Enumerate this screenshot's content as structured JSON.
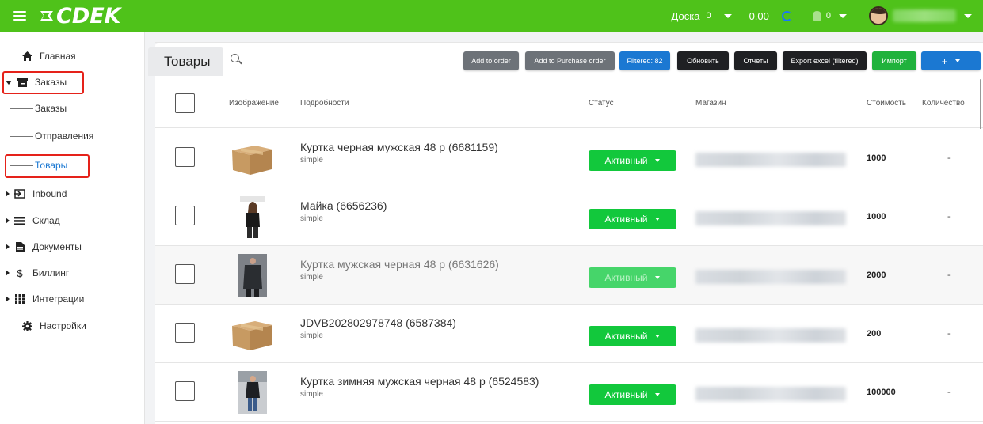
{
  "header": {
    "logo_text": "CDEK",
    "board_label": "Доска",
    "board_count": "0",
    "balance": "0.00",
    "notifications_count": "0"
  },
  "sidebar": {
    "items": [
      {
        "label": "Главная",
        "icon": "home-icon"
      },
      {
        "label": "Заказы",
        "icon": "orders-icon",
        "expanded": true
      },
      {
        "label": "Inbound",
        "icon": "inbound-icon"
      },
      {
        "label": "Склад",
        "icon": "warehouse-icon"
      },
      {
        "label": "Документы",
        "icon": "document-icon"
      },
      {
        "label": "Биллинг",
        "icon": "dollar-icon"
      },
      {
        "label": "Интеграции",
        "icon": "integrations-icon"
      },
      {
        "label": "Настройки",
        "icon": "gear-icon"
      }
    ],
    "subitems": [
      {
        "label": "Заказы"
      },
      {
        "label": "Отправления"
      },
      {
        "label": "Товары",
        "active": true
      }
    ]
  },
  "main": {
    "title": "Товары",
    "toolbar": {
      "add_to_order": "Add to order",
      "add_to_purchase_order": "Add to Purchase order",
      "filtered": "Filtered: 82",
      "refresh": "Обновить",
      "reports": "Отчеты",
      "export_excel": "Export excel (filtered)",
      "import": "Импорт",
      "plus": "+"
    },
    "columns": {
      "image": "Изображение",
      "details": "Подробности",
      "status": "Статус",
      "shop": "Магазин",
      "cost": "Стоимость",
      "quantity": "Количество"
    },
    "rows": [
      {
        "title": "Куртка черная мужская 48 р (6681159)",
        "type": "simple",
        "status": "Активный",
        "cost": "1000",
        "qty": "-"
      },
      {
        "title": "Майка (6656236)",
        "type": "simple",
        "status": "Активный",
        "cost": "1000",
        "qty": "-"
      },
      {
        "title": "Куртка мужская черная 48 р (6631626)",
        "type": "simple",
        "status": "Активный",
        "cost": "2000",
        "qty": "-"
      },
      {
        "title": "JDVB202802978748 (6587384)",
        "type": "simple",
        "status": "Активный",
        "cost": "200",
        "qty": "-"
      },
      {
        "title": "Куртка зимняя мужская черная 48 р (6524583)",
        "type": "simple",
        "status": "Активный",
        "cost": "100000",
        "qty": "-"
      }
    ]
  },
  "colors": {
    "brand_green": "#4fc21a",
    "status_green": "#12c83c",
    "highlight_red": "#e5221a",
    "primary_blue": "#1b78d2"
  }
}
